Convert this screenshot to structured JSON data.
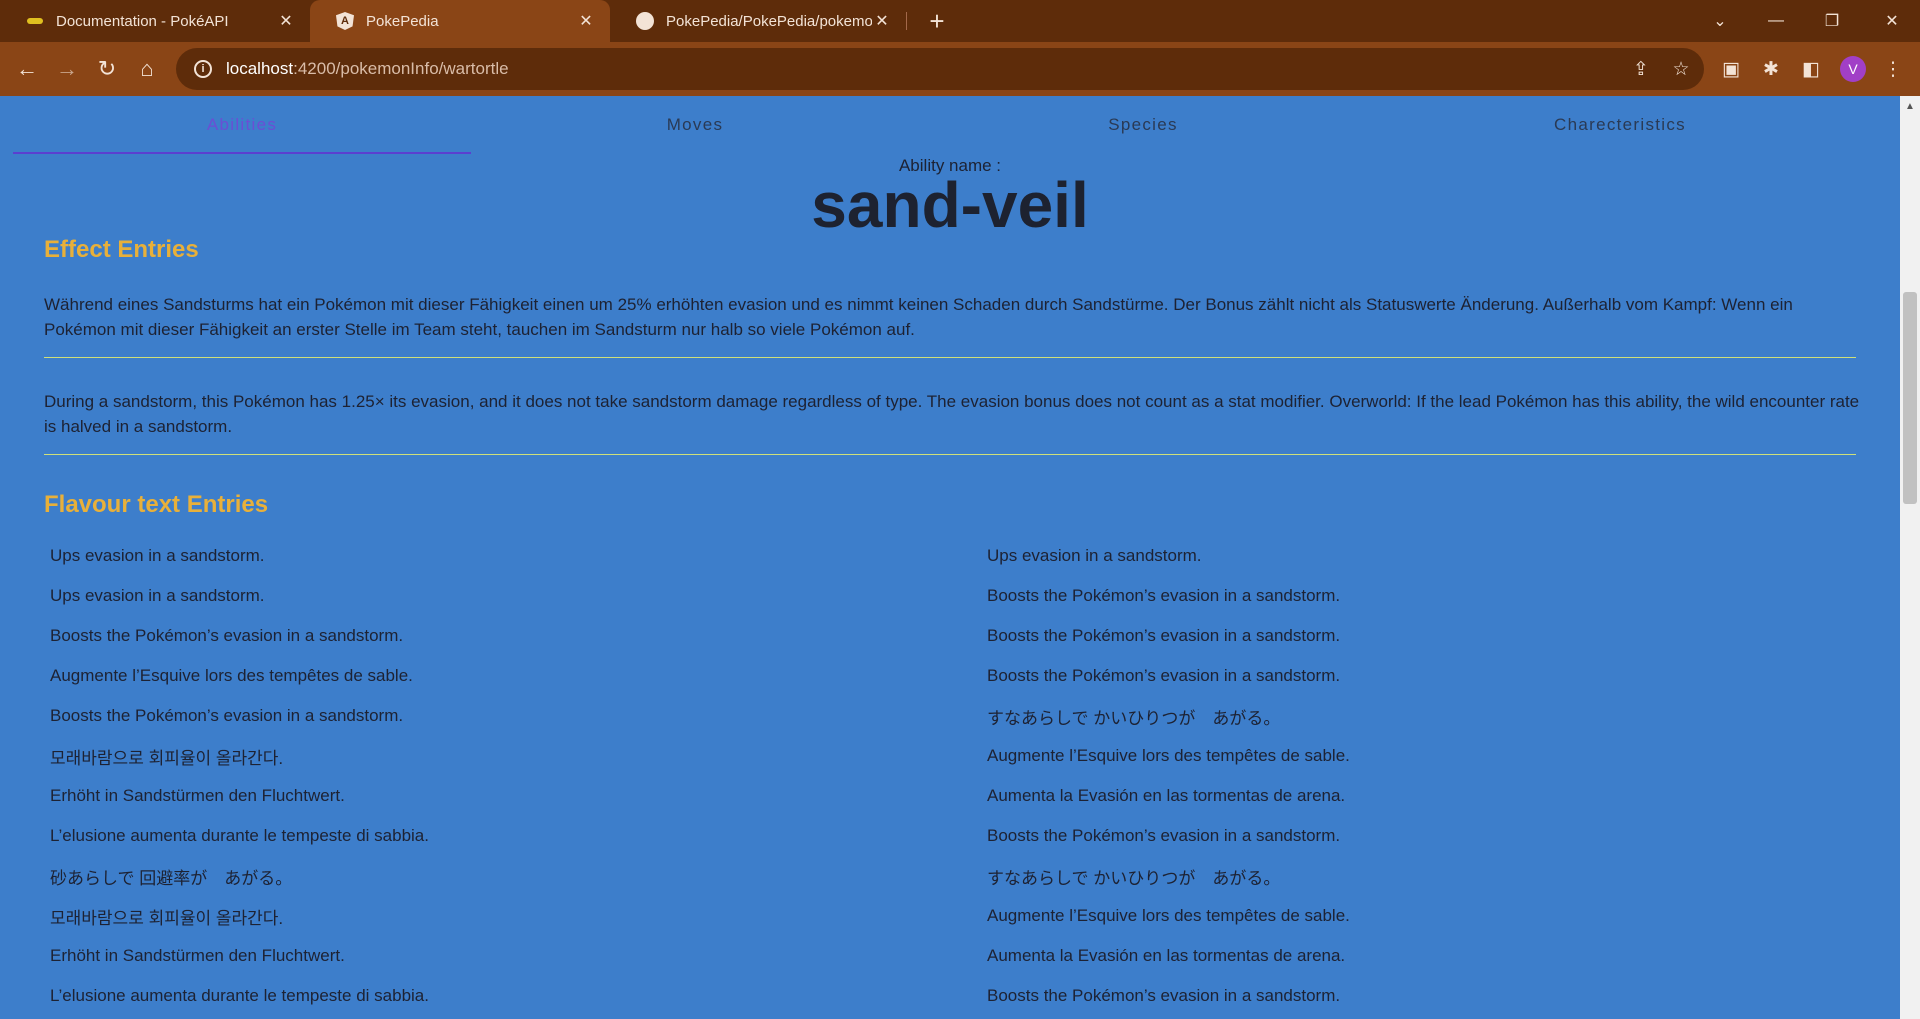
{
  "browser": {
    "tabs": [
      {
        "title": "Documentation - PokéAPI",
        "icon": "pokeapi-favicon"
      },
      {
        "title": "PokePedia",
        "icon": "angular-favicon",
        "active": true
      },
      {
        "title": "PokePedia/PokePedia/pokemon",
        "icon": "github-favicon"
      }
    ],
    "url_host": "localhost",
    "url_path": ":4200/pokemonInfo/wartortle",
    "profile_initial": "V"
  },
  "page": {
    "tabs": [
      "Abilities",
      "Moves",
      "Species",
      "Charecteristics"
    ],
    "active_tab": "Abilities",
    "ability_label": "Ability name :",
    "ability_name": "sand-veil",
    "effect_title": "Effect Entries",
    "effect_entries": [
      "Während eines Sandsturms hat ein Pokémon mit dieser Fähigkeit einen um 25% erhöhten evasion und es nimmt keinen Schaden durch Sandstürme. Der Bonus zählt nicht als Statuswerte Änderung. Außerhalb vom Kampf: Wenn ein Pokémon mit dieser Fähigkeit an erster Stelle im Team steht, tauchen im Sandsturm nur halb so viele Pokémon auf.",
      "During a sandstorm, this Pokémon has 1.25× its evasion, and it does not take sandstorm damage regardless of type. The evasion bonus does not count as a stat modifier. Overworld: If the lead Pokémon has this ability, the wild encounter rate is halved in a sandstorm."
    ],
    "flavour_title": "Flavour text Entries",
    "flavour_left": [
      "Ups evasion in a sandstorm.",
      "Ups evasion in a sandstorm.",
      "Boosts the Pokémon’s evasion in a sandstorm.",
      "Augmente l’Esquive lors des tempêtes de sable.",
      "Boosts the Pokémon’s evasion in a sandstorm.",
      "모래바람으로 회피율이 올라간다.",
      "Erhöht in Sandstürmen den Fluchtwert.",
      "L’elusione aumenta durante le tempeste di sabbia.",
      "砂あらしで 回避率が　あがる。",
      "모래바람으로 회피율이 올라간다.",
      "Erhöht in Sandstürmen den Fluchtwert.",
      "L’elusione aumenta durante le tempeste di sabbia."
    ],
    "flavour_right": [
      "Ups evasion in a sandstorm.",
      "Boosts the Pokémon’s evasion in a sandstorm.",
      "Boosts the Pokémon’s evasion in a sandstorm.",
      "Boosts the Pokémon’s evasion in a sandstorm.",
      "すなあらしで かいひりつが　あがる。",
      "Augmente l’Esquive lors des tempêtes de sable.",
      "Aumenta la Evasión en las tormentas de arena.",
      "Boosts the Pokémon’s evasion in a sandstorm.",
      "すなあらしで かいひりつが　あがる。",
      "Augmente l’Esquive lors des tempêtes de sable.",
      "Aumenta la Evasión en las tormentas de arena.",
      "Boosts the Pokémon’s evasion in a sandstorm."
    ]
  },
  "colors": {
    "page_background": "#3d7ecb",
    "section_title": "#e8b03a",
    "active_tab": "#6a4fd4",
    "divider": "#cfe07a",
    "browser_frame": "#5e2c0a",
    "browser_toolbar": "#8a4516"
  }
}
